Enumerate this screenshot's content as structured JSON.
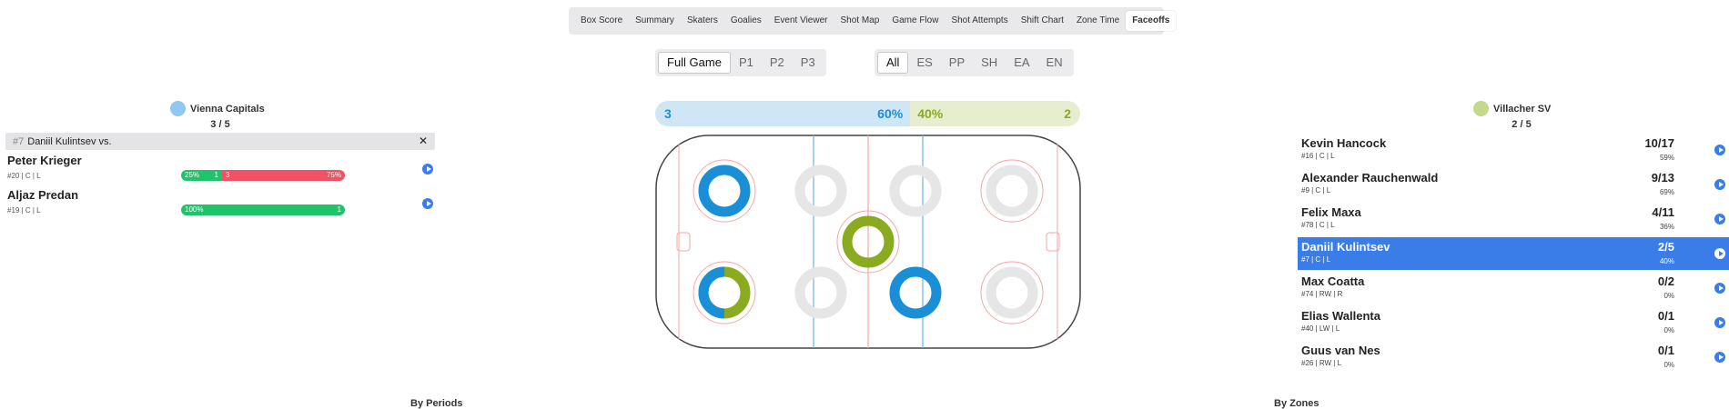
{
  "nav": {
    "tabs": [
      "Box Score",
      "Summary",
      "Skaters",
      "Goalies",
      "Event Viewer",
      "Shot Map",
      "Game Flow",
      "Shot Attempts",
      "Shift Chart",
      "Zone Time",
      "Faceoffs"
    ],
    "active": "Faceoffs"
  },
  "filters": {
    "periods": [
      "Full Game",
      "P1",
      "P2",
      "P3"
    ],
    "period_active": "Full Game",
    "strengths": [
      "All",
      "ES",
      "PP",
      "SH",
      "EA",
      "EN"
    ],
    "strength_active": "All"
  },
  "home_team": {
    "name": "Vienna Capitals",
    "record": "3 / 5",
    "color": "#8ec9ef",
    "accent": "#1a8fd8"
  },
  "away_team": {
    "name": "Villacher SV",
    "record": "2 / 5",
    "color": "#c4d98a",
    "accent": "#8aab1f"
  },
  "selected": {
    "number": "#7",
    "label": "Daniil Kulintsev vs."
  },
  "opponents": [
    {
      "name": "Peter Krieger",
      "meta": "#20 | C | L",
      "win_pct": "25%",
      "wins": "1",
      "losses": "3",
      "loss_pct": "75%",
      "win_frac": 0.25
    },
    {
      "name": "Aljaz Predan",
      "meta": "#19 | C | L",
      "win_pct": "100%",
      "wins": "1",
      "losses": "",
      "loss_pct": "",
      "win_frac": 1.0
    }
  ],
  "center_bar": {
    "home_count": "3",
    "home_pct": "60%",
    "away_pct": "40%",
    "away_count": "2"
  },
  "rink_dots": [
    {
      "spot": "home-zone-top",
      "home": 1.0
    },
    {
      "spot": "home-zone-bottom",
      "home": 0.5
    },
    {
      "spot": "home-neutral-top",
      "home": null
    },
    {
      "spot": "home-neutral-bottom",
      "home": null
    },
    {
      "spot": "center",
      "home": 0.0
    },
    {
      "spot": "away-neutral-top",
      "home": null
    },
    {
      "spot": "away-neutral-bottom",
      "home": 1.0
    },
    {
      "spot": "away-zone-top",
      "home": null
    },
    {
      "spot": "away-zone-bottom",
      "home": null
    }
  ],
  "players": [
    {
      "name": "Kevin Hancock",
      "meta": "#16 | C | L",
      "score": "10/17",
      "pct": "59%",
      "selected": false
    },
    {
      "name": "Alexander Rauchenwald",
      "meta": "#9 | C | L",
      "score": "9/13",
      "pct": "69%",
      "selected": false
    },
    {
      "name": "Felix Maxa",
      "meta": "#78 | C | L",
      "score": "4/11",
      "pct": "36%",
      "selected": false
    },
    {
      "name": "Daniil Kulintsev",
      "meta": "#7 | C | L",
      "score": "2/5",
      "pct": "40%",
      "selected": true
    },
    {
      "name": "Max Coatta",
      "meta": "#74 | RW | R",
      "score": "0/2",
      "pct": "0%",
      "selected": false
    },
    {
      "name": "Elias Wallenta",
      "meta": "#40 | LW | L",
      "score": "0/1",
      "pct": "0%",
      "selected": false
    },
    {
      "name": "Guus van Nes",
      "meta": "#26 | RW | L",
      "score": "0/1",
      "pct": "0%",
      "selected": false
    }
  ],
  "sections": {
    "by_periods": "By Periods",
    "by_zones": "By Zones"
  }
}
